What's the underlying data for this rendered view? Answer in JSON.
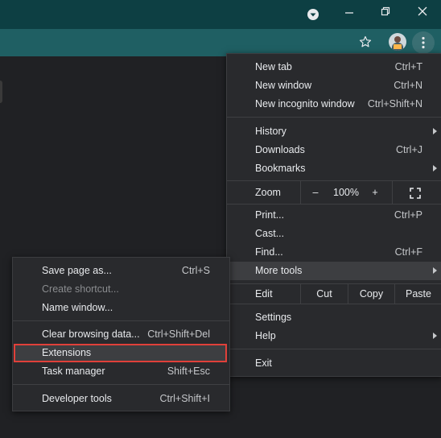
{
  "window": {
    "titlebar_color": "#0d3f43",
    "toolbar_color": "#1f5f63",
    "icons": [
      "tab-search-icon",
      "minimize-icon",
      "restore-icon",
      "close-icon",
      "bookmark-star-icon",
      "avatar",
      "kebab-menu-icon"
    ]
  },
  "main_menu": {
    "group1": [
      {
        "label": "New tab",
        "shortcut": "Ctrl+T"
      },
      {
        "label": "New window",
        "shortcut": "Ctrl+N"
      },
      {
        "label": "New incognito window",
        "shortcut": "Ctrl+Shift+N"
      }
    ],
    "group2": [
      {
        "label": "History",
        "shortcut": ""
      },
      {
        "label": "Downloads",
        "shortcut": "Ctrl+J"
      },
      {
        "label": "Bookmarks",
        "shortcut": ""
      }
    ],
    "zoom": {
      "label": "Zoom",
      "minus": "–",
      "value": "100%",
      "plus": "+"
    },
    "group3": [
      {
        "label": "Print...",
        "shortcut": "Ctrl+P"
      },
      {
        "label": "Cast...",
        "shortcut": ""
      },
      {
        "label": "Find...",
        "shortcut": "Ctrl+F"
      },
      {
        "label": "More tools",
        "shortcut": ""
      }
    ],
    "edit": {
      "label": "Edit",
      "cut": "Cut",
      "copy": "Copy",
      "paste": "Paste"
    },
    "group4": [
      {
        "label": "Settings",
        "shortcut": ""
      },
      {
        "label": "Help",
        "shortcut": ""
      }
    ],
    "exit": {
      "label": "Exit"
    }
  },
  "more_tools_menu": {
    "items": [
      {
        "label": "Save page as...",
        "shortcut": "Ctrl+S"
      },
      {
        "label": "Create shortcut...",
        "shortcut": ""
      },
      {
        "label": "Name window...",
        "shortcut": ""
      },
      {
        "label": "Clear browsing data...",
        "shortcut": "Ctrl+Shift+Del"
      },
      {
        "label": "Extensions",
        "shortcut": ""
      },
      {
        "label": "Task manager",
        "shortcut": "Shift+Esc"
      },
      {
        "label": "Developer tools",
        "shortcut": "Ctrl+Shift+I"
      }
    ],
    "highlight_color": "#e0403a"
  }
}
